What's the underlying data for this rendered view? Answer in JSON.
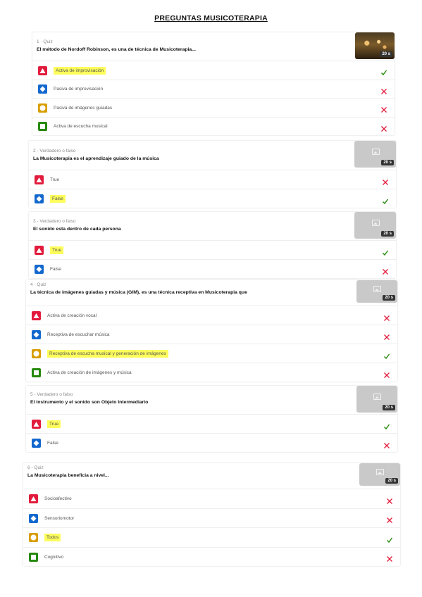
{
  "doc_title": "PREGUNTAS MUSICOTERAPIA",
  "colors": {
    "red": "#e21b3c",
    "blue": "#1368ce",
    "yellow": "#d89e00",
    "green": "#26890c",
    "highlight": "#fdfd5c",
    "correct": "#26890c",
    "wrong": "#e21b3c"
  },
  "questions": [
    {
      "meta": "1 · Quiz",
      "text": "El método de Nordoff Robinson, es una de técnica de Musicoterapia...",
      "time": "20 s",
      "answers": [
        {
          "label": "Activa de improvisación",
          "shape": "triangle",
          "correct": true,
          "highlighted": true
        },
        {
          "label": "Pasiva de improvisación",
          "shape": "diamond",
          "correct": false,
          "highlighted": false
        },
        {
          "label": "Pasiva de imágenes guiadas",
          "shape": "circle",
          "correct": false,
          "highlighted": false
        },
        {
          "label": "Activa de escucha musical",
          "shape": "square",
          "correct": false,
          "highlighted": false
        }
      ]
    },
    {
      "meta": "2 - Verdadero o falso",
      "text": "La Musicoterapia es el aprendizaje guiado de la música",
      "time": "20 s",
      "answers": [
        {
          "label": "True",
          "shape": "triangle",
          "correct": false,
          "highlighted": false
        },
        {
          "label": "False",
          "shape": "diamond",
          "correct": true,
          "highlighted": true
        }
      ]
    },
    {
      "meta": "3 - Verdadero o falso",
      "text": "El sonido esta dentro de cada persona",
      "time": "20 s",
      "answers": [
        {
          "label": "True",
          "shape": "triangle",
          "correct": true,
          "highlighted": true
        },
        {
          "label": "False",
          "shape": "diamond",
          "correct": false,
          "highlighted": false
        }
      ]
    },
    {
      "meta": "4 · Quiz",
      "text": "La técnica de imágenes guiadas y música (GIM), es una técnica receptiva en Musicoterapia que",
      "time": "20 s",
      "answers": [
        {
          "label": "Activa de creación vocal",
          "shape": "triangle",
          "correct": false,
          "highlighted": false
        },
        {
          "label": "Receptiva de escuchar música",
          "shape": "diamond",
          "correct": false,
          "highlighted": false
        },
        {
          "label": "Receptiva de escucha musical y generación de imágenes",
          "shape": "circle",
          "correct": true,
          "highlighted": true
        },
        {
          "label": "Activa de creación de imágenes y música",
          "shape": "square",
          "correct": false,
          "highlighted": false
        }
      ]
    },
    {
      "meta": "5 - Verdadero o falso",
      "text": "El instrumento y el sonido son Objeto Intermediario",
      "time": "20 s",
      "answers": [
        {
          "label": "True",
          "shape": "triangle",
          "correct": true,
          "highlighted": true
        },
        {
          "label": "False",
          "shape": "diamond",
          "correct": false,
          "highlighted": false
        }
      ]
    },
    {
      "meta": "6 - Quiz",
      "text": "La Musicoterapia beneficia a nivel...",
      "time": "20 s",
      "answers": [
        {
          "label": "Socioafectivo",
          "shape": "triangle",
          "correct": false,
          "highlighted": false
        },
        {
          "label": "Sensoriomotor",
          "shape": "diamond",
          "correct": false,
          "highlighted": false
        },
        {
          "label": "Todos",
          "shape": "circle",
          "correct": true,
          "highlighted": true
        },
        {
          "label": "Cognitivo",
          "shape": "square",
          "correct": false,
          "highlighted": false
        }
      ]
    }
  ]
}
